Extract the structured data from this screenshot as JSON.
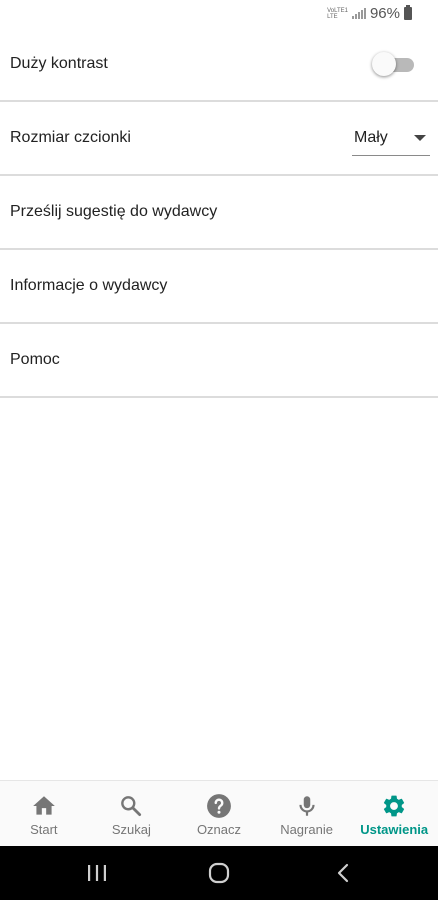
{
  "status_bar": {
    "net_line1": "VoLTE1",
    "net_line2": "LTE",
    "battery": "96%"
  },
  "settings": [
    {
      "label": "Duży kontrast",
      "control": "toggle",
      "on": false
    },
    {
      "label": "Rozmiar czcionki",
      "control": "select",
      "value": "Mały"
    },
    {
      "label": "Prześlij sugestię do wydawcy"
    },
    {
      "label": "Informacje o wydawcy"
    },
    {
      "label": "Pomoc"
    }
  ],
  "bottom_nav": {
    "items": [
      {
        "label": "Start",
        "icon": "home-icon"
      },
      {
        "label": "Szukaj",
        "icon": "search-icon"
      },
      {
        "label": "Oznacz",
        "icon": "help-icon"
      },
      {
        "label": "Nagranie",
        "icon": "microphone-icon"
      },
      {
        "label": "Ustawienia",
        "icon": "gear-icon",
        "active": true
      }
    ],
    "active_color": "#009688",
    "inactive_color": "#767676"
  },
  "system_nav": {
    "icons": [
      "recent-apps-icon",
      "home-circle-icon",
      "back-icon"
    ]
  }
}
